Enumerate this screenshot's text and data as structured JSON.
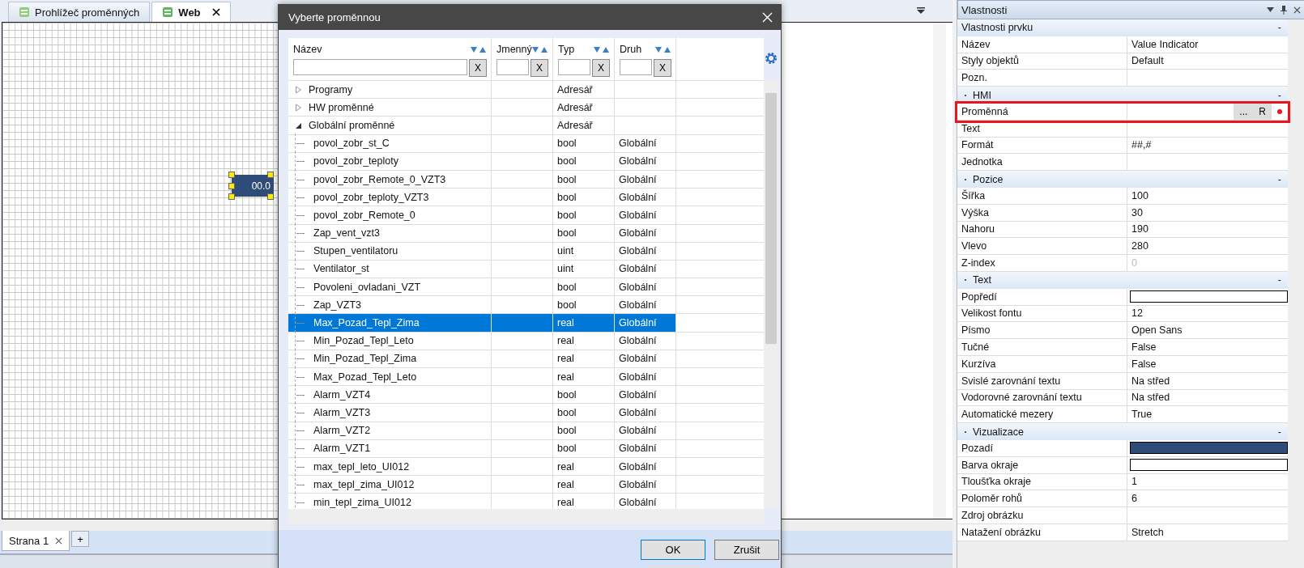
{
  "editor": {
    "tabs": [
      {
        "label": "Prohlížeč proměnných",
        "selected": false,
        "closable": false
      },
      {
        "label": "Web",
        "selected": true,
        "closable": true
      }
    ],
    "indicator": {
      "text": "00.0",
      "selected": true
    },
    "page_tabs": [
      {
        "label": "Strana 1"
      }
    ],
    "add_page": "+"
  },
  "dialog": {
    "title": "Vyberte proměnnou",
    "columns": [
      {
        "label": "Název",
        "clear": "X"
      },
      {
        "label": "Jmenný",
        "clear": "X"
      },
      {
        "label": "Typ",
        "clear": "X"
      },
      {
        "label": "Druh",
        "clear": "X"
      }
    ],
    "tree": [
      {
        "name": "Programy",
        "type": "Adresář",
        "expanded": false,
        "selected": false
      },
      {
        "name": "HW proměnné",
        "type": "Adresář",
        "expanded": false,
        "selected": false
      },
      {
        "name": "Globální proměnné",
        "type": "Adresář",
        "expanded": true,
        "selected": false,
        "children": [
          {
            "name": "povol_zobr_st_C",
            "type": "bool",
            "scope": "Globální",
            "selected": false
          },
          {
            "name": "povol_zobr_teploty",
            "type": "bool",
            "scope": "Globální",
            "selected": false
          },
          {
            "name": "povol_zobr_Remote_0_VZT3",
            "type": "bool",
            "scope": "Globální",
            "selected": false
          },
          {
            "name": "povol_zobr_teploty_VZT3",
            "type": "bool",
            "scope": "Globální",
            "selected": false
          },
          {
            "name": "povol_zobr_Remote_0",
            "type": "bool",
            "scope": "Globální",
            "selected": false
          },
          {
            "name": "Zap_vent_vzt3",
            "type": "bool",
            "scope": "Globální",
            "selected": false
          },
          {
            "name": "Stupen_ventilatoru",
            "type": "uint",
            "scope": "Globální",
            "selected": false
          },
          {
            "name": "Ventilator_st",
            "type": "uint",
            "scope": "Globální",
            "selected": false
          },
          {
            "name": "Povoleni_ovladani_VZT",
            "type": "bool",
            "scope": "Globální",
            "selected": false
          },
          {
            "name": "Zap_VZT3",
            "type": "bool",
            "scope": "Globální",
            "selected": false
          },
          {
            "name": "Max_Pozad_Tepl_Zima",
            "type": "real",
            "scope": "Globální",
            "selected": true
          },
          {
            "name": "Min_Pozad_Tepl_Leto",
            "type": "real",
            "scope": "Globální",
            "selected": false
          },
          {
            "name": "Min_Pozad_Tepl_Zima",
            "type": "real",
            "scope": "Globální",
            "selected": false
          },
          {
            "name": "Max_Pozad_Tepl_Leto",
            "type": "real",
            "scope": "Globální",
            "selected": false
          },
          {
            "name": "Alarm_VZT4",
            "type": "bool",
            "scope": "Globální",
            "selected": false
          },
          {
            "name": "Alarm_VZT3",
            "type": "bool",
            "scope": "Globální",
            "selected": false
          },
          {
            "name": "Alarm_VZT2",
            "type": "bool",
            "scope": "Globální",
            "selected": false
          },
          {
            "name": "Alarm_VZT1",
            "type": "bool",
            "scope": "Globální",
            "selected": false
          },
          {
            "name": "max_tepl_leto_UI012",
            "type": "real",
            "scope": "Globální",
            "selected": false
          },
          {
            "name": "max_tepl_zima_UI012",
            "type": "real",
            "scope": "Globální",
            "selected": false
          },
          {
            "name": "min_tepl_zima_UI012",
            "type": "real",
            "scope": "Globální",
            "selected": false
          }
        ]
      }
    ],
    "buttons": [
      {
        "label": "OK",
        "kind": "primary"
      },
      {
        "label": "Zrušit",
        "kind": "normal"
      }
    ]
  },
  "properties": {
    "title": "Vlastnosti",
    "sections": [
      {
        "title": "Vlastnosti prvku",
        "bullet": false,
        "toggle": "-",
        "rows": [
          {
            "kind": "text",
            "label": "Název",
            "value": "Value Indicator"
          },
          {
            "kind": "text",
            "label": "Styly objektů",
            "value": "Default"
          },
          {
            "kind": "text",
            "label": "Pozn."
          }
        ]
      },
      {
        "title": "HMI",
        "bullet": true,
        "toggle": "-",
        "rows": [
          {
            "kind": "variable",
            "label": "Proměnná",
            "highlighted": true,
            "buttons": [
              "...",
              "R"
            ]
          },
          {
            "kind": "text",
            "label": "Text"
          },
          {
            "kind": "text",
            "label": "Formát",
            "value": "##,#"
          },
          {
            "kind": "text",
            "label": "Jednotka"
          }
        ]
      },
      {
        "title": "Pozice",
        "bullet": true,
        "toggle": "-",
        "rows": [
          {
            "kind": "text",
            "label": "Šířka",
            "value": "100"
          },
          {
            "kind": "text",
            "label": "Výška",
            "value": "30"
          },
          {
            "kind": "text",
            "label": "Nahoru",
            "value": "190"
          },
          {
            "kind": "text",
            "label": "Vlevo",
            "value": "280"
          },
          {
            "kind": "text",
            "label": "Z-index",
            "value": "0",
            "disabled": true
          }
        ]
      },
      {
        "title": "Text",
        "bullet": true,
        "toggle": "-",
        "rows": [
          {
            "kind": "color",
            "label": "Popředí",
            "color": "#ffffff"
          },
          {
            "kind": "text",
            "label": "Velikost fontu",
            "value": "12"
          },
          {
            "kind": "text",
            "label": "Písmo",
            "value": "Open Sans"
          },
          {
            "kind": "text",
            "label": "Tučné",
            "value": "False"
          },
          {
            "kind": "text",
            "label": "Kurzíva",
            "value": "False"
          },
          {
            "kind": "text",
            "label": "Svislé zarovnání textu",
            "value": "Na střed"
          },
          {
            "kind": "text",
            "label": "Vodorovné zarovnání textu",
            "value": "Na střed"
          },
          {
            "kind": "text",
            "label": "Automatické mezery",
            "value": "True"
          }
        ]
      },
      {
        "title": "Vizualizace",
        "bullet": true,
        "toggle": "-",
        "rows": [
          {
            "kind": "color",
            "label": "Pozadí",
            "color": "#2f4b77"
          },
          {
            "kind": "color",
            "label": "Barva okraje",
            "color": "#ffffff"
          },
          {
            "kind": "text",
            "label": "Tloušťka okraje",
            "value": "1"
          },
          {
            "kind": "text",
            "label": "Poloměr rohů",
            "value": "6"
          },
          {
            "kind": "text",
            "label": "Zdroj obrázku"
          },
          {
            "kind": "text",
            "label": "Natažení obrázku",
            "value": "Stretch"
          }
        ]
      }
    ]
  }
}
